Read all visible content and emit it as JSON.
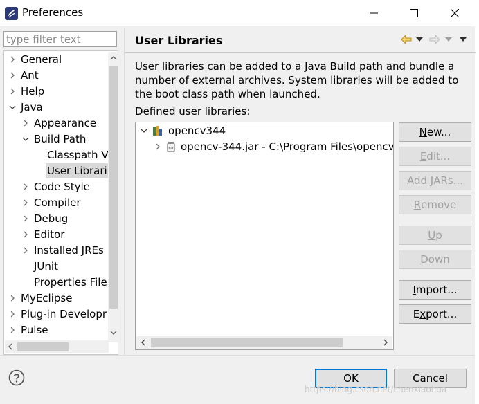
{
  "window": {
    "title": "Preferences",
    "accent": "#0078d7"
  },
  "titlebar_icons": [
    "eclipse-logo-icon",
    "minimize-icon",
    "maximize-icon",
    "close-icon"
  ],
  "filter": {
    "placeholder": "type filter text",
    "value": ""
  },
  "tree": {
    "items": [
      {
        "label": "General",
        "expander": "collapsed"
      },
      {
        "label": "Ant",
        "expander": "collapsed"
      },
      {
        "label": "Help",
        "expander": "collapsed"
      },
      {
        "label": "Java",
        "expander": "expanded"
      },
      {
        "label": "Appearance",
        "expander": "collapsed"
      },
      {
        "label": "Build Path",
        "expander": "expanded"
      },
      {
        "label": "Classpath V",
        "expander": "none"
      },
      {
        "label": "User Librari",
        "expander": "none",
        "selected": true
      },
      {
        "label": "Code Style",
        "expander": "collapsed"
      },
      {
        "label": "Compiler",
        "expander": "collapsed"
      },
      {
        "label": "Debug",
        "expander": "collapsed"
      },
      {
        "label": "Editor",
        "expander": "collapsed"
      },
      {
        "label": "Installed JREs",
        "expander": "collapsed"
      },
      {
        "label": "JUnit",
        "expander": "none"
      },
      {
        "label": "Properties File",
        "expander": "none"
      },
      {
        "label": "MyEclipse",
        "expander": "collapsed"
      },
      {
        "label": "Plug-in Developr",
        "expander": "collapsed"
      },
      {
        "label": "Pulse",
        "expander": "collapsed"
      }
    ]
  },
  "page": {
    "title": "User Libraries",
    "description": "User libraries can be added to a Java Build path and bundle a number of external archives. System libraries will be added to the boot class path when launched.",
    "defined_label_mnemonic": "D",
    "defined_label_rest": "efined user libraries:",
    "nav_icons": [
      "back-arrow-icon",
      "forward-arrow-icon",
      "view-menu-icon"
    ]
  },
  "libraries": {
    "items": [
      {
        "label": "opencv344",
        "icon": "library-icon",
        "expander": "expanded"
      },
      {
        "label": "opencv-344.jar - C:\\Program Files\\opencv\\",
        "icon": "jar-icon",
        "expander": "collapsed"
      }
    ]
  },
  "buttons": [
    {
      "pre": "",
      "mn": "N",
      "post": "ew...",
      "enabled": true
    },
    {
      "pre": "",
      "mn": "E",
      "post": "dit...",
      "enabled": false
    },
    {
      "pre": "Add ",
      "mn": "J",
      "post": "ARs...",
      "enabled": false
    },
    {
      "pre": "",
      "mn": "R",
      "post": "emove",
      "enabled": false
    },
    {
      "pre": "",
      "mn": "U",
      "post": "p",
      "enabled": false
    },
    {
      "pre": "",
      "mn": "D",
      "post": "own",
      "enabled": false
    },
    {
      "pre": "",
      "mn": "I",
      "post": "mport...",
      "enabled": true
    },
    {
      "pre": "E",
      "mn": "x",
      "post": "port...",
      "enabled": true
    }
  ],
  "dialog": {
    "ok": "OK",
    "cancel": "Cancel"
  },
  "watermark": "https://blog.csdn.net/chenxiaohua"
}
